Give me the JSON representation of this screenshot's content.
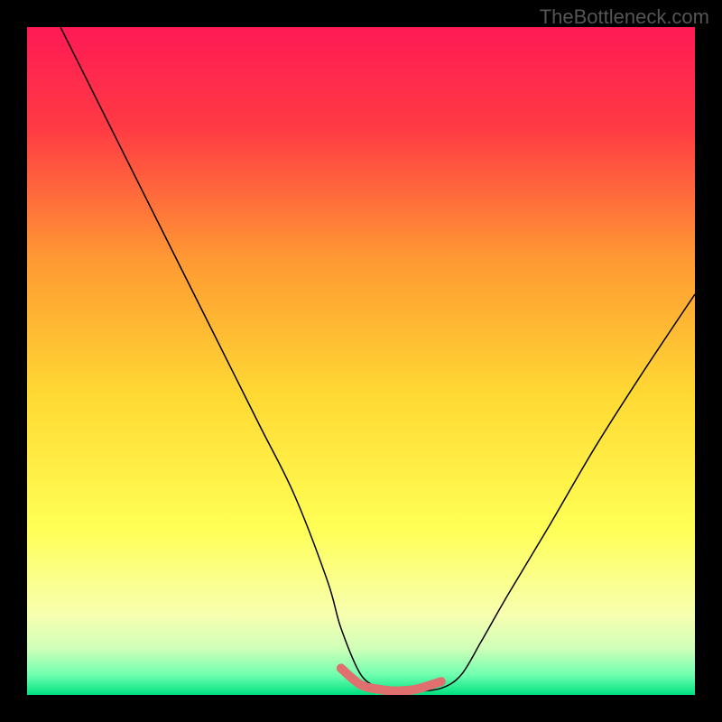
{
  "watermark": "TheBottleneck.com",
  "chart_data": {
    "type": "line",
    "title": "",
    "xlabel": "",
    "ylabel": "",
    "xlim": [
      0,
      100
    ],
    "ylim": [
      0,
      100
    ],
    "background_gradient": {
      "type": "vertical",
      "stops": [
        {
          "pos": 0.0,
          "color": "#ff1a55"
        },
        {
          "pos": 0.15,
          "color": "#ff3a44"
        },
        {
          "pos": 0.35,
          "color": "#ff9a33"
        },
        {
          "pos": 0.55,
          "color": "#ffd933"
        },
        {
          "pos": 0.75,
          "color": "#ffff55"
        },
        {
          "pos": 0.88,
          "color": "#f7ffb0"
        },
        {
          "pos": 0.93,
          "color": "#d0ffb8"
        },
        {
          "pos": 0.97,
          "color": "#70ffb0"
        },
        {
          "pos": 1.0,
          "color": "#00e080"
        }
      ]
    },
    "series": [
      {
        "name": "bottleneck-curve",
        "stroke": "#000000",
        "stroke_width": 1.5,
        "x": [
          5,
          10,
          15,
          20,
          25,
          30,
          35,
          40,
          45,
          47,
          50,
          53,
          55,
          58,
          62,
          65,
          68,
          72,
          78,
          85,
          92,
          100
        ],
        "y": [
          100,
          90,
          80,
          70,
          60,
          50,
          40,
          30,
          17,
          10,
          3,
          1,
          0.5,
          0.5,
          1,
          3,
          8,
          15,
          25,
          37,
          48,
          60
        ]
      },
      {
        "name": "optimal-zone-marker",
        "stroke": "#e07070",
        "stroke_width": 10,
        "x": [
          47,
          50,
          53,
          55,
          58,
          62
        ],
        "y": [
          4,
          1.5,
          0.8,
          0.6,
          0.8,
          2
        ]
      }
    ],
    "annotations": []
  }
}
